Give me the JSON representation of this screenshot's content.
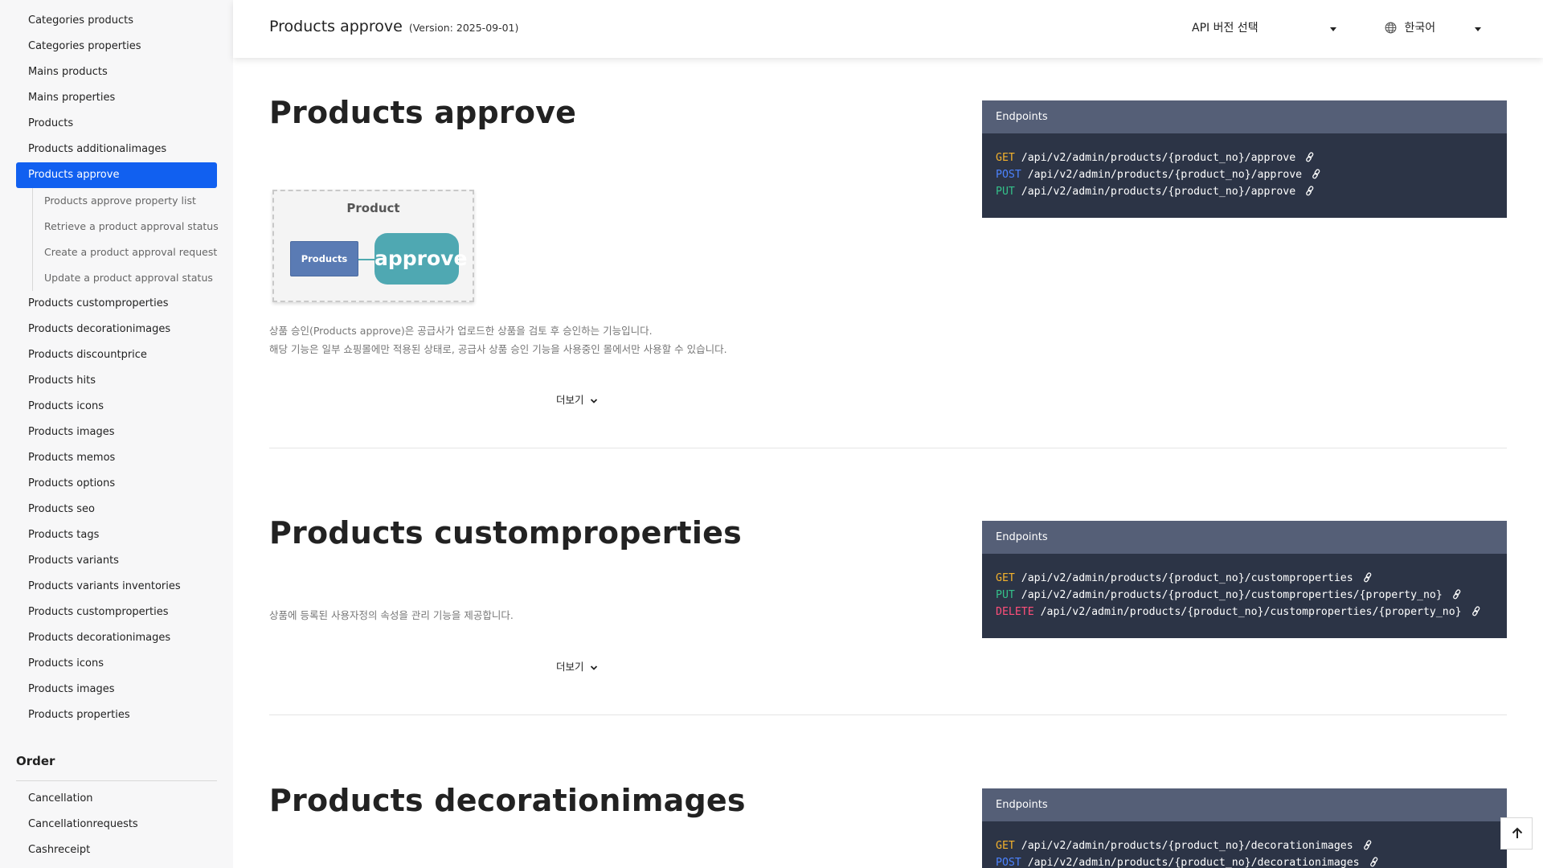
{
  "sidebar": {
    "items": [
      {
        "label": "Categories products"
      },
      {
        "label": "Categories properties"
      },
      {
        "label": "Mains products"
      },
      {
        "label": "Mains properties"
      },
      {
        "label": "Products"
      },
      {
        "label": "Products additionalimages"
      },
      {
        "label": "Products approve"
      }
    ],
    "sub_items": [
      {
        "label": "Products approve property list"
      },
      {
        "label": "Retrieve a product approval status"
      },
      {
        "label": "Create a product approval request"
      },
      {
        "label": "Update a product approval status"
      }
    ],
    "items_after": [
      {
        "label": "Products customproperties"
      },
      {
        "label": "Products decorationimages"
      },
      {
        "label": "Products discountprice"
      },
      {
        "label": "Products hits"
      },
      {
        "label": "Products icons"
      },
      {
        "label": "Products images"
      },
      {
        "label": "Products memos"
      },
      {
        "label": "Products options"
      },
      {
        "label": "Products seo"
      },
      {
        "label": "Products tags"
      },
      {
        "label": "Products variants"
      },
      {
        "label": "Products variants inventories"
      },
      {
        "label": "Products customproperties"
      },
      {
        "label": "Products decorationimages"
      },
      {
        "label": "Products icons"
      },
      {
        "label": "Products images"
      },
      {
        "label": "Products properties"
      }
    ],
    "section_title": "Order",
    "order_items": [
      {
        "label": "Cancellation"
      },
      {
        "label": "Cancellationrequests"
      },
      {
        "label": "Cashreceipt"
      }
    ]
  },
  "header": {
    "title": "Products approve",
    "version": "(Version: 2025-09-01)",
    "version_select": "API 버전 선택",
    "language": "한국어"
  },
  "sections": [
    {
      "title": "Products approve",
      "endpoints_label": "Endpoints",
      "endpoints": [
        {
          "method": "GET",
          "path": "/api/v2/admin/products/{product_no}/approve"
        },
        {
          "method": "POST",
          "path": "/api/v2/admin/products/{product_no}/approve"
        },
        {
          "method": "PUT",
          "path": "/api/v2/admin/products/{product_no}/approve"
        }
      ],
      "diagram": {
        "title": "Product",
        "box": "Products",
        "pill": "approve"
      },
      "desc1": "상품 승인(Products approve)은 공급사가 업로드한 상품을 검토 후 승인하는 기능입니다.",
      "desc2": "해당 기능은 일부 쇼핑몰에만 적용된 상태로, 공급사 상품 승인 기능을 사용중인 몰에서만 사용할 수 있습니다.",
      "more": "더보기"
    },
    {
      "title": "Products customproperties",
      "endpoints_label": "Endpoints",
      "endpoints": [
        {
          "method": "GET",
          "path": "/api/v2/admin/products/{product_no}/customproperties"
        },
        {
          "method": "PUT",
          "path": "/api/v2/admin/products/{product_no}/customproperties/{property_no}"
        },
        {
          "method": "DELETE",
          "path": "/api/v2/admin/products/{product_no}/customproperties/{property_no}"
        }
      ],
      "desc1": "상품에 등록된 사용자정의 속성을 관리 기능을 제공합니다.",
      "more": "더보기"
    },
    {
      "title": "Products decorationimages",
      "endpoints_label": "Endpoints",
      "endpoints": [
        {
          "method": "GET",
          "path": "/api/v2/admin/products/{product_no}/decorationimages"
        },
        {
          "method": "POST",
          "path": "/api/v2/admin/products/{product_no}/decorationimages"
        }
      ]
    }
  ],
  "colors": {
    "accent": "#1160f0",
    "get": "#f3b12c",
    "post": "#4c83ff",
    "put": "#34c08a",
    "delete": "#ff4e7a"
  },
  "icons": {
    "link": "link-icon",
    "globe": "globe-icon",
    "chevron": "chevron-down-icon",
    "top": "arrow-up-icon"
  }
}
